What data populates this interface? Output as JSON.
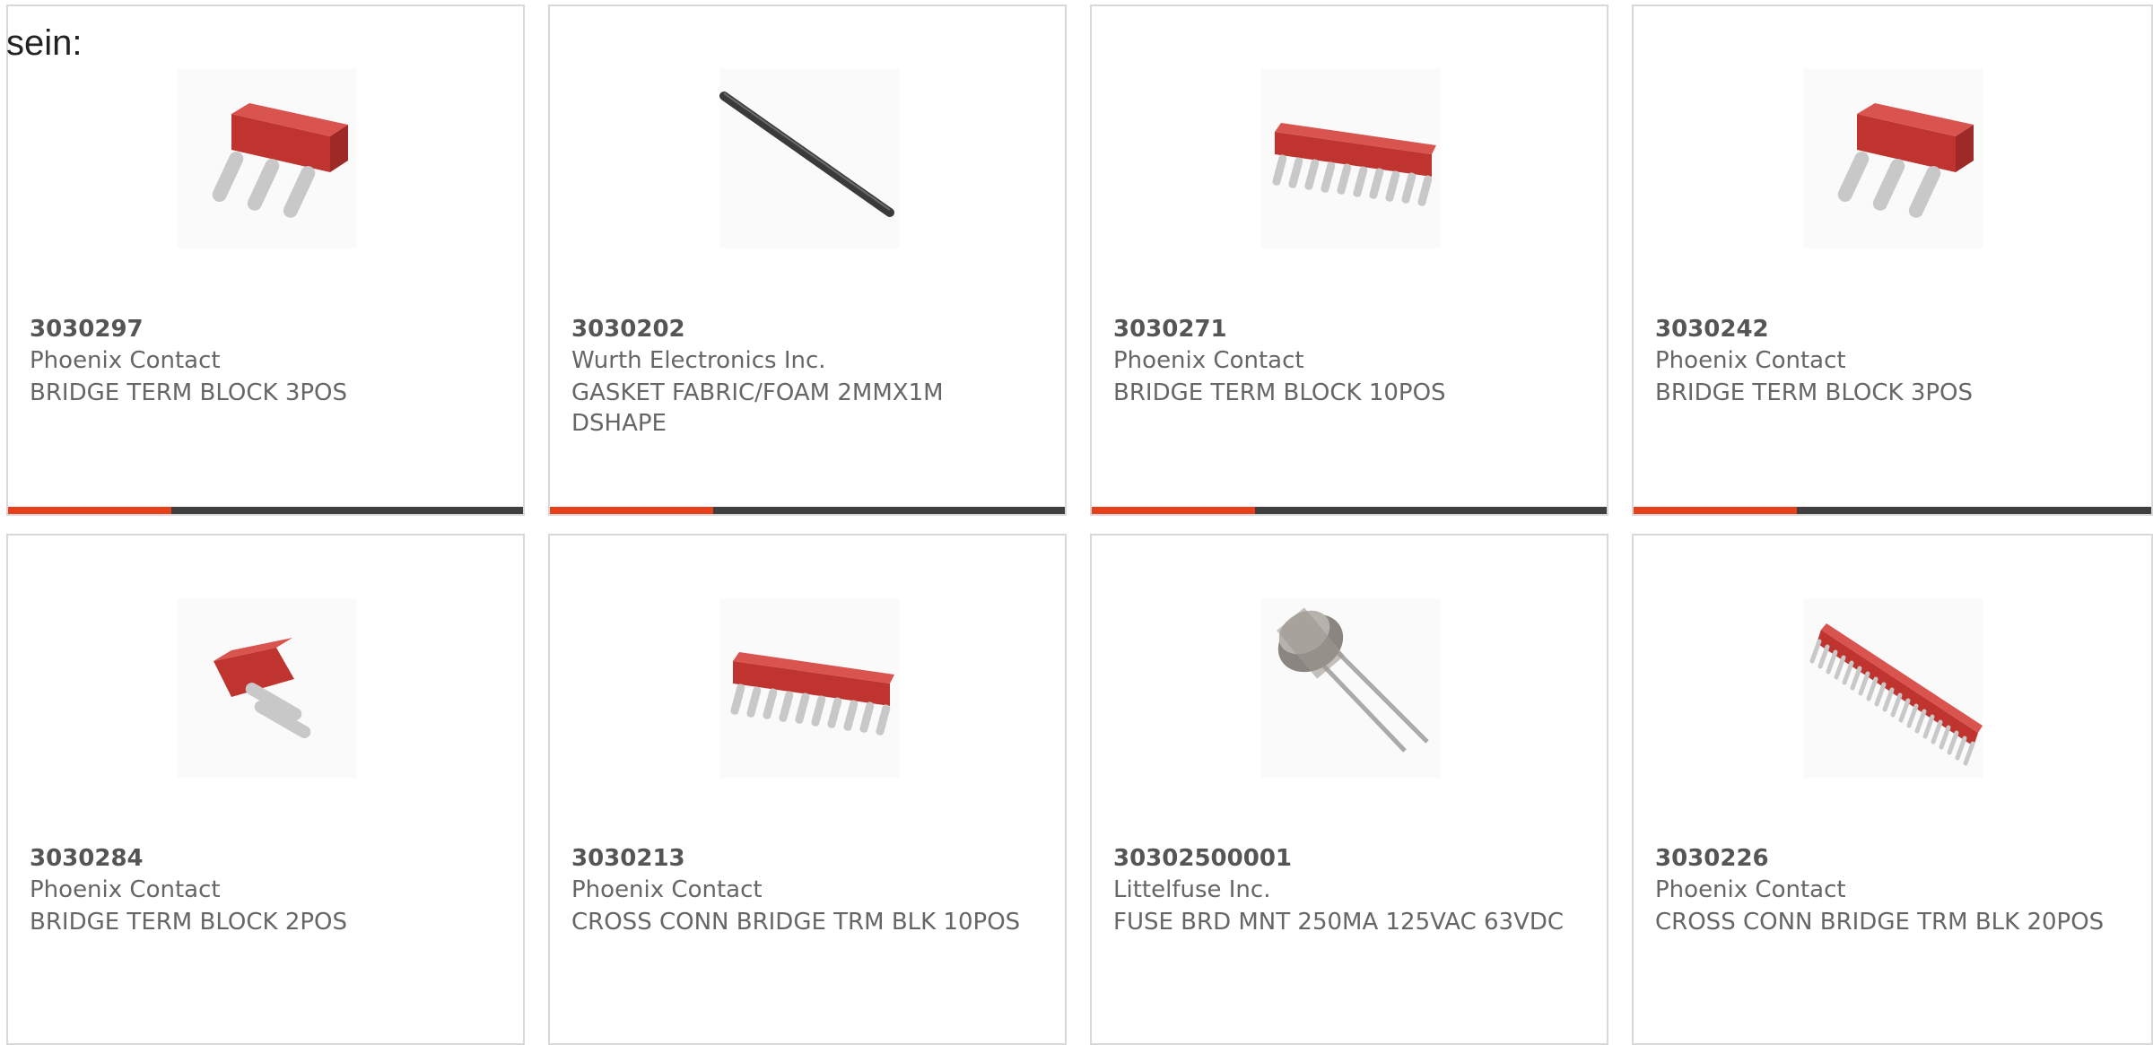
{
  "intro_text": "sein:",
  "colors": {
    "accent": "#e8401c",
    "bar_dark": "#3f3f3f",
    "part_red": "#c03430"
  },
  "products": [
    {
      "part": "3030297",
      "manufacturer": "Phoenix Contact",
      "description": "BRIDGE TERM BLOCK 3POS",
      "image": "bridge-3pos"
    },
    {
      "part": "3030202",
      "manufacturer": "Wurth Electronics Inc.",
      "description": "GASKET FABRIC/FOAM 2MMX1M DSHAPE",
      "image": "gasket"
    },
    {
      "part": "3030271",
      "manufacturer": "Phoenix Contact",
      "description": "BRIDGE TERM BLOCK 10POS",
      "image": "bridge-10pos"
    },
    {
      "part": "3030242",
      "manufacturer": "Phoenix Contact",
      "description": "BRIDGE TERM BLOCK 3POS",
      "image": "bridge-3pos"
    },
    {
      "part": "3030284",
      "manufacturer": "Phoenix Contact",
      "description": "BRIDGE TERM BLOCK 2POS",
      "image": "bridge-2pos"
    },
    {
      "part": "3030213",
      "manufacturer": "Phoenix Contact",
      "description": "CROSS CONN BRIDGE TRM BLK 10POS",
      "image": "bridge-10pos"
    },
    {
      "part": "30302500001",
      "manufacturer": "Littelfuse Inc.",
      "description": "FUSE BRD MNT 250MA 125VAC 63VDC",
      "image": "fuse"
    },
    {
      "part": "3030226",
      "manufacturer": "Phoenix Contact",
      "description": "CROSS CONN BRIDGE TRM BLK 20POS",
      "image": "bridge-20pos"
    }
  ]
}
